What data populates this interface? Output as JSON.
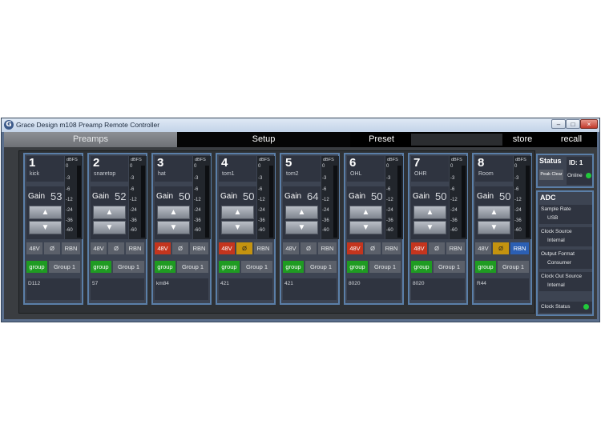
{
  "window": {
    "title": "Grace Design m108 Preamp Remote Controller",
    "icon": "G",
    "min": "–",
    "max": "□",
    "close": "×"
  },
  "tabs": {
    "preamps": "Preamps",
    "setup": "Setup",
    "preset": "Preset",
    "store": "store",
    "recall": "recall"
  },
  "meter": {
    "unit": "dBFS",
    "ticks": [
      "0",
      "-3",
      "-6",
      "-12",
      "-24",
      "-36",
      "-60"
    ]
  },
  "labels": {
    "gain": "Gain",
    "up_arrow": "▲",
    "down_arrow": "▼"
  },
  "channels": [
    {
      "number": "1",
      "name": "kick",
      "gain": "53",
      "phantom": "48V",
      "phase": "Ø",
      "ribbon": "RBN",
      "group": "group",
      "group_name": "Group 1",
      "mic": "D112"
    },
    {
      "number": "2",
      "name": "snaretop",
      "gain": "52",
      "phantom": "48V",
      "phase": "Ø",
      "ribbon": "RBN",
      "group": "group",
      "group_name": "Group 1",
      "mic": "57"
    },
    {
      "number": "3",
      "name": "hat",
      "gain": "50",
      "phantom": "48V",
      "phase": "Ø",
      "ribbon": "RBN",
      "group": "group",
      "group_name": "Group 1",
      "mic": "km84"
    },
    {
      "number": "4",
      "name": "tom1",
      "gain": "50",
      "phantom": "48V",
      "phase": "Ø",
      "ribbon": "RBN",
      "group": "group",
      "group_name": "Group 1",
      "mic": "421"
    },
    {
      "number": "5",
      "name": "tom2",
      "gain": "64",
      "phantom": "48V",
      "phase": "Ø",
      "ribbon": "RBN",
      "group": "group",
      "group_name": "Group 1",
      "mic": "421"
    },
    {
      "number": "6",
      "name": "OHL",
      "gain": "50",
      "phantom": "48V",
      "phase": "Ø",
      "ribbon": "RBN",
      "group": "group",
      "group_name": "Group 1",
      "mic": "8020"
    },
    {
      "number": "7",
      "name": "OHR",
      "gain": "50",
      "phantom": "48V",
      "phase": "Ø",
      "ribbon": "RBN",
      "group": "group",
      "group_name": "Group 1",
      "mic": "8020"
    },
    {
      "number": "8",
      "name": "Room",
      "gain": "50",
      "phantom": "48V",
      "phase": "Ø",
      "ribbon": "RBN",
      "group": "group",
      "group_name": "Group 1",
      "mic": "R44"
    }
  ],
  "status": {
    "title": "Status",
    "peak_clear": "Peak Clear",
    "id": "ID: 1",
    "online": "Online"
  },
  "adc": {
    "title": "ADC",
    "items": [
      {
        "label": "Sample Rate",
        "value": "USB"
      },
      {
        "label": "Clock Source",
        "value": "Internal"
      },
      {
        "label": "Output Format",
        "value": "Consumer"
      },
      {
        "label": "Clock Out Source",
        "value": "Internal"
      }
    ],
    "clock_status": "Clock Status"
  },
  "colors": {
    "phantom_on": "#c4351e",
    "phase_on": "#c4930f",
    "ribbon_on": "#2b5fb3",
    "group_on": "#1f9b22",
    "led_on": "#21c93b",
    "accent_border": "#5b7fa8"
  }
}
